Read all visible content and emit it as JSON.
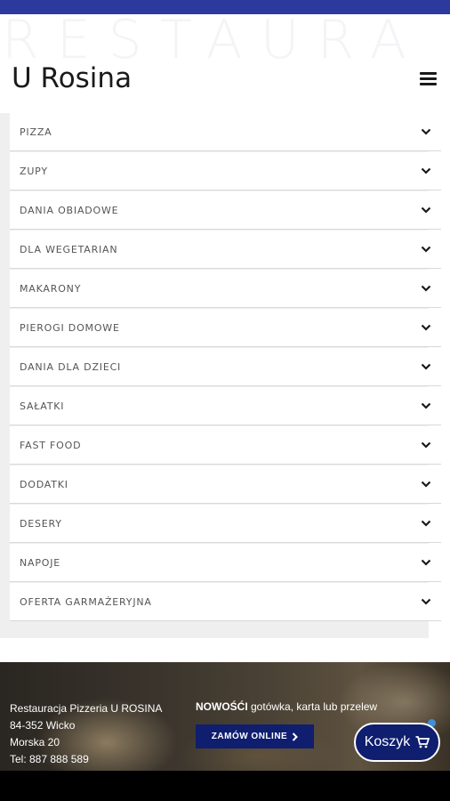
{
  "header": {
    "watermark": "RESTAURA",
    "brand": "U Rosina"
  },
  "menu": {
    "items": [
      {
        "label": "PIZZA"
      },
      {
        "label": "ZUPY"
      },
      {
        "label": "DANIA OBIADOWE"
      },
      {
        "label": "DLA WEGETARIAN"
      },
      {
        "label": "MAKARONY"
      },
      {
        "label": "PIEROGI DOMOWE"
      },
      {
        "label": "DANIA DLA DZIECI"
      },
      {
        "label": "SAŁATKI"
      },
      {
        "label": "FAST FOOD"
      },
      {
        "label": "DODATKI"
      },
      {
        "label": "DESERY"
      },
      {
        "label": "NAPOJE"
      },
      {
        "label": "OFERTA GARMAŻERYJNA"
      }
    ]
  },
  "footer": {
    "address": {
      "name": "Restauracja Pizzeria U ROSINA",
      "postal": "84-352 Wicko",
      "street": "Morska 20",
      "phone": "Tel: 887 888 589"
    },
    "news": {
      "highlight": "NOWOŚĆI",
      "text": " gotówka, karta lub przelew"
    },
    "order_label": "ZAMÓW ONLINE",
    "cart_label": "Koszyk"
  },
  "colors": {
    "accent": "#2b3a9c",
    "button": "#0f1e6e",
    "cart_dot": "#3f8fd8"
  }
}
